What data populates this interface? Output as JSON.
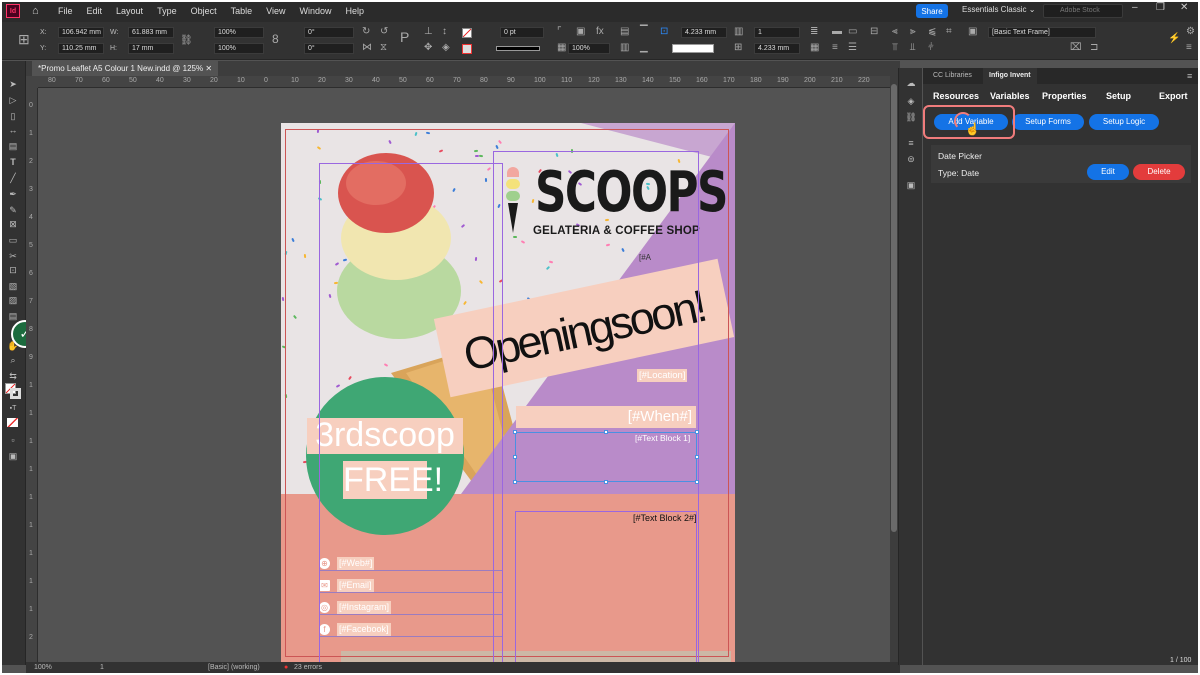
{
  "menubar": {
    "app_logo": "Id",
    "items": [
      "File",
      "Edit",
      "Layout",
      "Type",
      "Object",
      "Table",
      "View",
      "Window",
      "Help"
    ],
    "share_label": "Share",
    "workspace_label": "Essentials Classic",
    "search_placeholder": "Adobe Stock"
  },
  "control": {
    "x_label": "X:",
    "x_value": "106.942 mm",
    "y_label": "Y:",
    "y_value": "110.25 mm",
    "w_label": "W:",
    "w_value": "61.883 mm",
    "h_label": "H:",
    "h_value": "17 mm",
    "scale_x": "100%",
    "scale_y": "100%",
    "angle": "0°",
    "shear": "0°",
    "stroke_weight": "0 pt",
    "opacity": "100%",
    "ref_w": "4.233 mm",
    "ref_h": "4.233 mm",
    "columns": "1",
    "style_name": "[Basic Text Frame]"
  },
  "document": {
    "tab_title": "*Promo Leaflet A5 Colour 1 New.indd @ 125%",
    "ruler_h": [
      "80",
      "70",
      "60",
      "50",
      "40",
      "30",
      "20",
      "10",
      "0",
      "10",
      "20",
      "30",
      "40",
      "50",
      "60",
      "70",
      "80",
      "90",
      "100",
      "110",
      "120",
      "130",
      "140",
      "150",
      "160",
      "170",
      "180",
      "190",
      "200",
      "210",
      "220"
    ],
    "ruler_v": [
      "0",
      "1",
      "2",
      "3",
      "4",
      "5",
      "6",
      "7",
      "8",
      "9",
      "1",
      "1",
      "1",
      "1",
      "1",
      "1",
      "1",
      "1",
      "1",
      "2"
    ]
  },
  "leaflet": {
    "brand_title": "SCOOPS",
    "brand_subtitle": "GELATERIA & COFFEE SHOP",
    "placeholder_top": "[#A",
    "headline": "Openingsoon!",
    "location_placeholder": "[#Location]",
    "when_placeholder": "[#When#]",
    "text_block_1": "[#Text Block 1]",
    "offer_line1": "3rdscoop",
    "offer_line2": "FREE!",
    "contacts": [
      {
        "icon": "globe-icon",
        "glyph": "⊕",
        "label": "[#Web#]"
      },
      {
        "icon": "email-icon",
        "glyph": "✉",
        "label": "[#Email]"
      },
      {
        "icon": "instagram-icon",
        "glyph": "◎",
        "label": "[#Instagram]"
      },
      {
        "icon": "facebook-icon",
        "glyph": "f",
        "label": "[#Facebook]"
      }
    ],
    "text_block_2": "[#Text Block 2#]",
    "colors": {
      "peach": "#f7cfbf",
      "salmon": "#e8998b",
      "green": "#3fa774",
      "purple": "#b98bc9"
    }
  },
  "status": {
    "zoom": "100%",
    "page": "1",
    "style": "[Basic] (working)",
    "errors": "23 errors"
  },
  "panel": {
    "tabs": [
      "CC Libraries",
      "Infigo Invent"
    ],
    "nav": [
      "Resources",
      "Variables",
      "Properties",
      "Setup",
      "Export"
    ],
    "buttons": {
      "add_variable": "Add Variable",
      "setup_forms": "Setup Forms",
      "setup_logic": "Setup Logic"
    },
    "variable": {
      "title": "Date Picker",
      "type": "Type: Date",
      "edit": "Edit",
      "delete": "Delete"
    },
    "page_count": "1 / 100"
  }
}
